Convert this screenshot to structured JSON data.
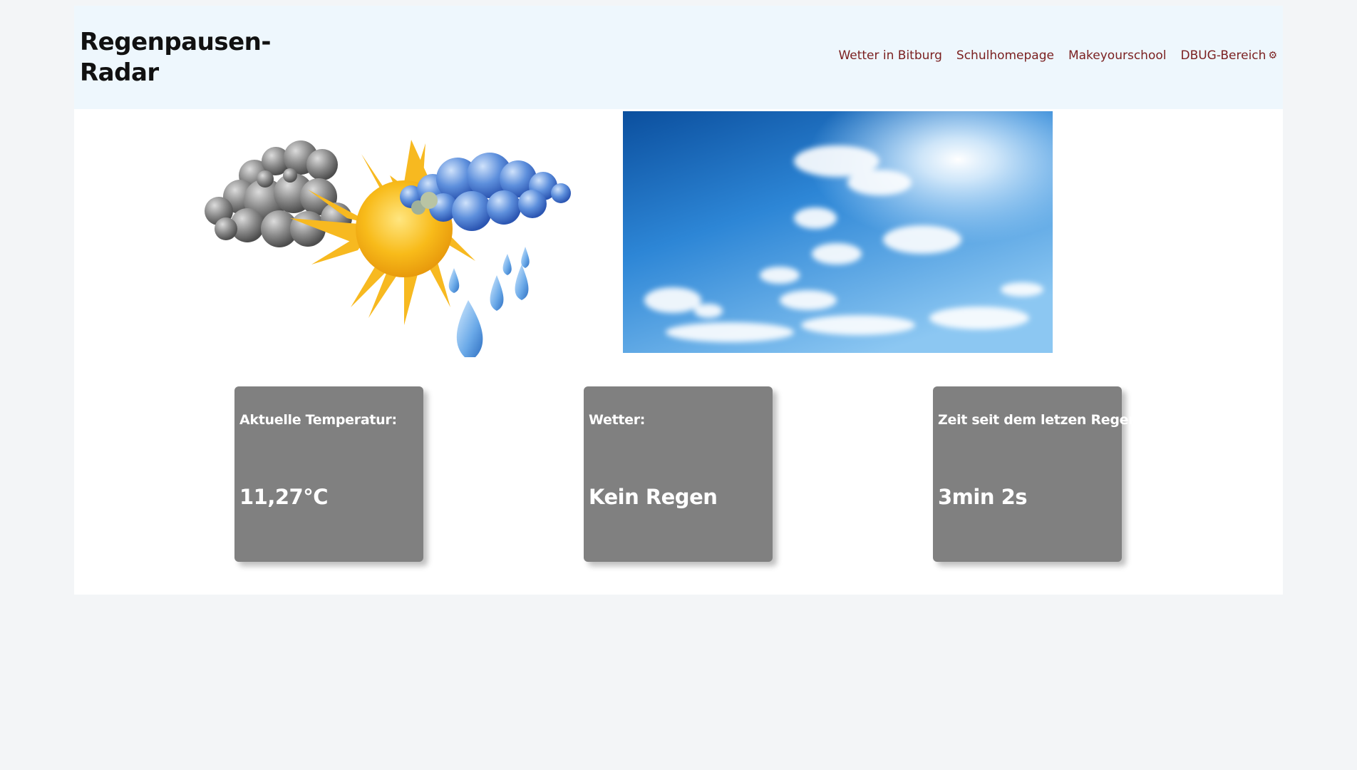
{
  "site": {
    "title": "Regenpausen-Radar"
  },
  "nav": {
    "items": [
      {
        "label": "Wetter in Bitburg"
      },
      {
        "label": "Schulhomepage"
      },
      {
        "label": "Makeyourschool"
      },
      {
        "label": "DBUG-Bereich"
      }
    ],
    "settings_icon": "gear-icon"
  },
  "hero": {
    "left_image": "sun-cloud-rain-icon",
    "right_image": "blue-sky-clouds-photo"
  },
  "cards": [
    {
      "label": "Aktuelle Temperatur:",
      "value": "11,27°C"
    },
    {
      "label": "Wetter:",
      "value": "Kein Regen"
    },
    {
      "label": "Zeit seit dem letzen Regen:",
      "value": "3min 2s"
    }
  ],
  "colors": {
    "header_bg": "#eef7fd",
    "nav_link": "#7a1f1f",
    "card_bg": "#808080",
    "page_bg": "#f3f5f7"
  }
}
